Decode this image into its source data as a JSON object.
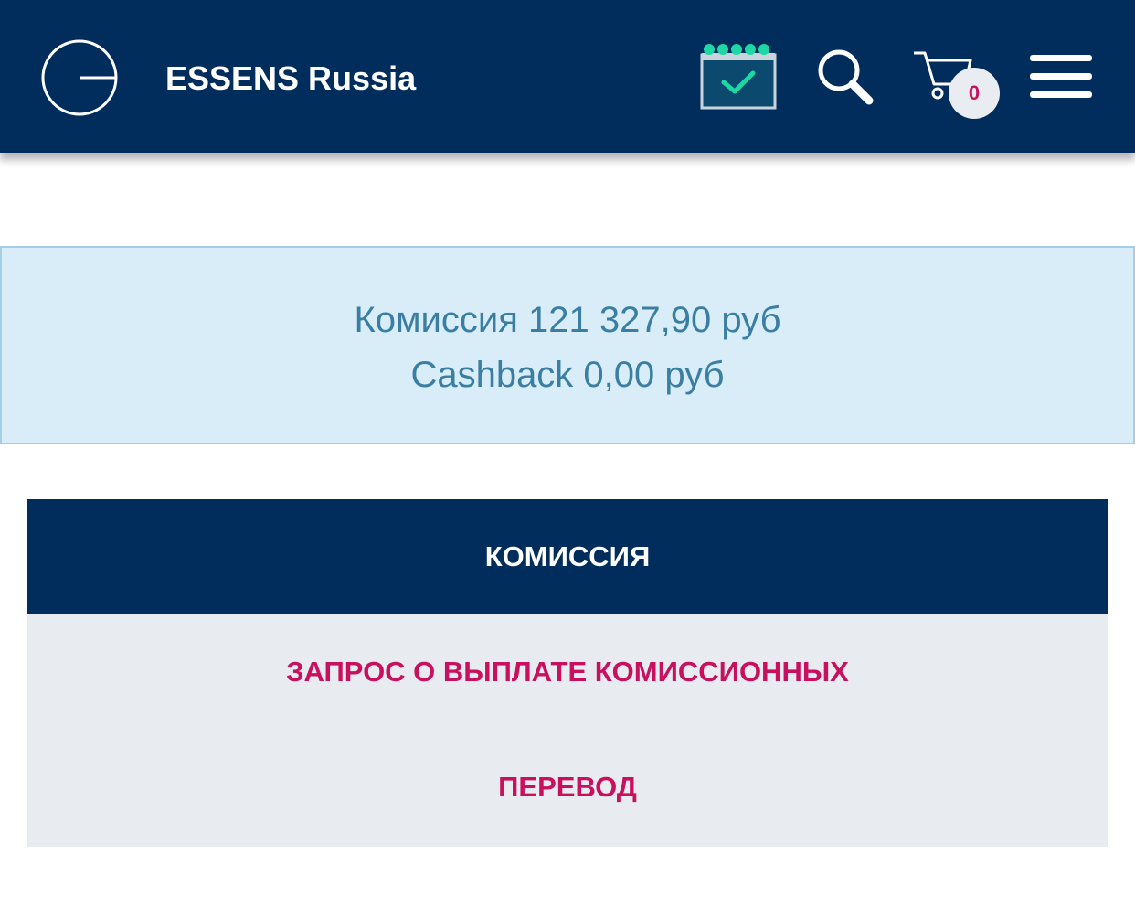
{
  "header": {
    "brand": "ESSENS Russia",
    "cart_count": "0",
    "icons": {
      "logo": "essens-logo",
      "calendar": "calendar-check-icon",
      "search": "search-icon",
      "cart": "cart-icon",
      "menu": "hamburger-menu-icon"
    }
  },
  "summary": {
    "commission": "Комиссия 121 327,90 руб",
    "cashback": "Cashback 0,00 руб"
  },
  "tabs": {
    "active_label": "КОМИССИЯ",
    "items": [
      {
        "label": "ЗАПРОС О ВЫПЛАТЕ КОМИССИОННЫХ"
      },
      {
        "label": "ПЕРЕВОД"
      }
    ]
  },
  "colors": {
    "header_bg": "#012d5c",
    "accent_green": "#1fd7a5",
    "link_pink": "#c8105f",
    "info_bg": "#d8edf7",
    "info_text": "#3a7fa3"
  }
}
